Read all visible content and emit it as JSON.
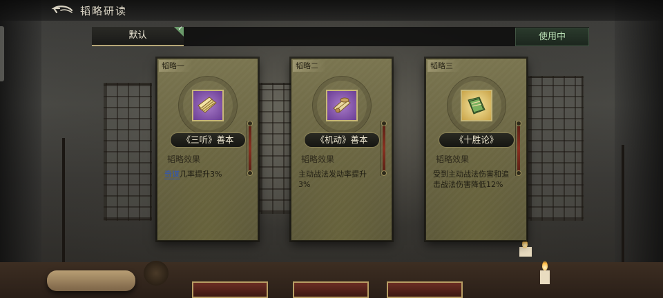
{
  "header": {
    "back_icon": "back-arrow-icon",
    "title": "韬略研读"
  },
  "preset": {
    "tabs": [
      {
        "label": "默认",
        "selected": true,
        "check_icon": "check-corner-icon"
      }
    ],
    "status_button": "使用中"
  },
  "cards": [
    {
      "tag": "韬略一",
      "item_icon": "purple-scroll-icon",
      "book_name": "《三听》善本",
      "effect_title": "韬略效果",
      "effect_link": "奇谋",
      "effect_text": "几率提升3%"
    },
    {
      "tag": "韬略二",
      "item_icon": "purple-scroll-icon",
      "book_name": "《机动》善本",
      "effect_title": "韬略效果",
      "effect_link": "",
      "effect_text": "主动战法发动率提升3%"
    },
    {
      "tag": "韬略三",
      "item_icon": "gold-book-icon",
      "book_name": "《十胜论》",
      "effect_title": "韬略效果",
      "effect_link": "",
      "effect_text": "受到主动战法伤害和追击战法伤害降低12%"
    }
  ],
  "colors": {
    "card_paper": "#6e6946",
    "purple_rarity": "#7a4aa4",
    "gold_rarity": "#d8bb66",
    "link_blue": "#2f56b8",
    "status_green": "#b9e0b4"
  }
}
